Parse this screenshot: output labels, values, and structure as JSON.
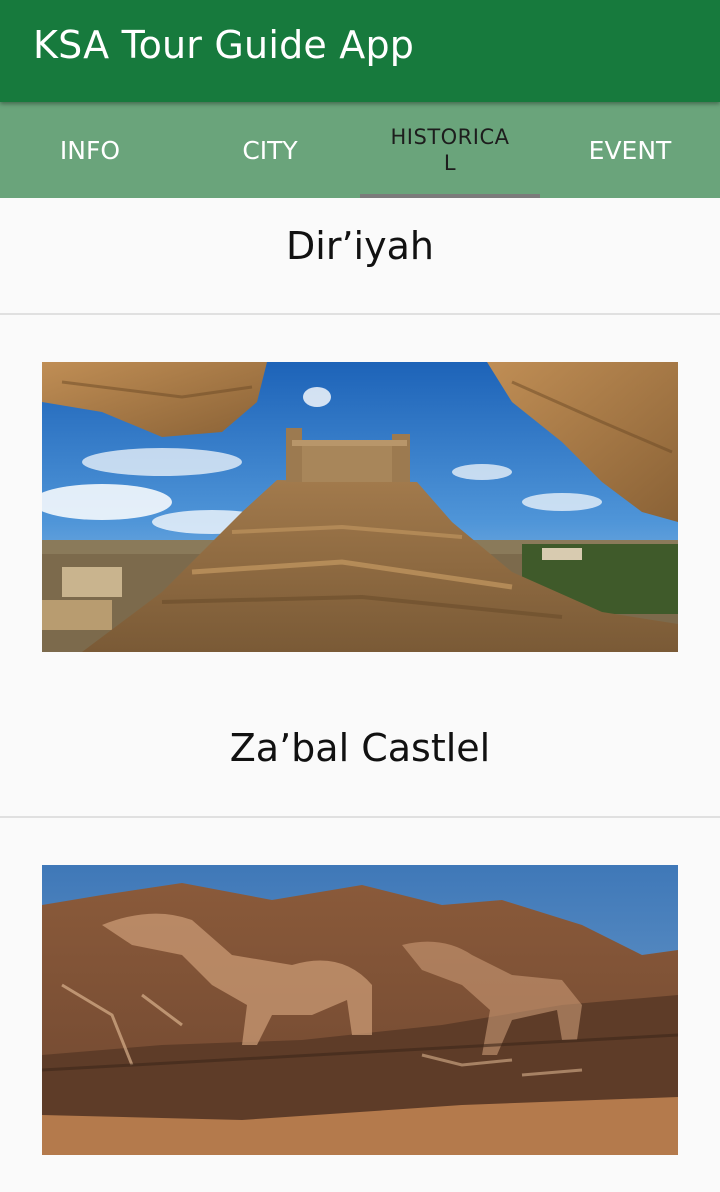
{
  "app_bar": {
    "title": "KSA Tour Guide App"
  },
  "tabs": [
    {
      "label": "INFO",
      "active": false
    },
    {
      "label": "CITY",
      "active": false
    },
    {
      "label": "HISTORICA\nL",
      "active": true
    },
    {
      "label": "EVENT",
      "active": false
    }
  ],
  "items": [
    {
      "title": "Dir’iyah",
      "image": "fortress-on-rock-photo"
    },
    {
      "title": "Za’bal Castlel",
      "image": "rock-art-camel-petroglyph-photo"
    }
  ],
  "colors": {
    "app_bar": "#177a3d",
    "tab_bar": "#6aa47b",
    "tab_indicator": "#7b7b7b",
    "background": "#fafafa"
  }
}
